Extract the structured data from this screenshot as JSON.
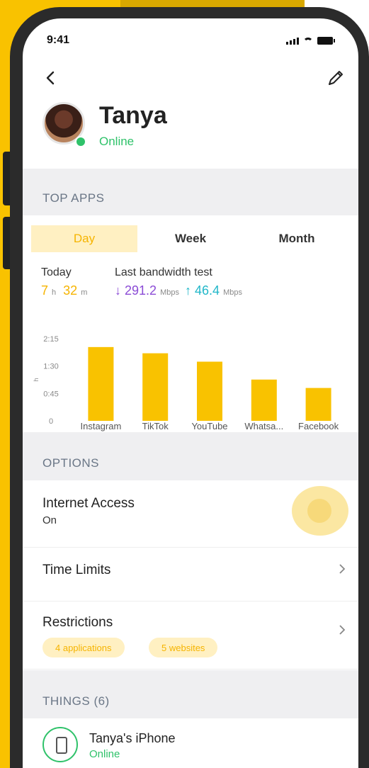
{
  "status": {
    "time": "9:41"
  },
  "profile": {
    "name": "Tanya",
    "presence": "Online"
  },
  "sections": {
    "top_apps": "TOP APPS",
    "options": "OPTIONS",
    "things": "THINGS (6)"
  },
  "tabs": [
    {
      "label": "Day",
      "active": true
    },
    {
      "label": "Week",
      "active": false
    },
    {
      "label": "Month",
      "active": false
    }
  ],
  "stats": {
    "today_label": "Today",
    "today_hours": "7",
    "today_hours_unit": "h",
    "today_minutes": "32",
    "today_minutes_unit": "m",
    "bandwidth_label": "Last bandwidth test",
    "down_arrow": "↓",
    "down_value": "291.2",
    "up_arrow": "↑",
    "up_value": "46.4",
    "unit": "Mbps"
  },
  "chart_data": {
    "type": "bar",
    "categories": [
      "Instagram",
      "TikTok",
      "YouTube",
      "Whatsa...",
      "Facebook"
    ],
    "values": [
      2.02,
      1.85,
      1.62,
      1.13,
      0.9
    ],
    "y_ticks": [
      "2:15",
      "1:30",
      "0:45",
      "0"
    ],
    "y_tick_values": [
      2.25,
      1.5,
      0.75,
      0
    ],
    "ylabel": "h",
    "ylim": [
      0,
      2.25
    ],
    "color": "#f9c200"
  },
  "options": {
    "internet_access": {
      "title": "Internet Access",
      "sub": "On"
    },
    "time_limits": {
      "title": "Time Limits"
    },
    "restrictions": {
      "title": "Restrictions",
      "chips": [
        "4 applications",
        "5 websites"
      ]
    }
  },
  "things": [
    {
      "title": "Tanya's iPhone",
      "status": "Online"
    }
  ],
  "colors": {
    "accent": "#f9c200",
    "online": "#2fc26a",
    "download": "#8b4bd6",
    "upload": "#21b7c9"
  }
}
